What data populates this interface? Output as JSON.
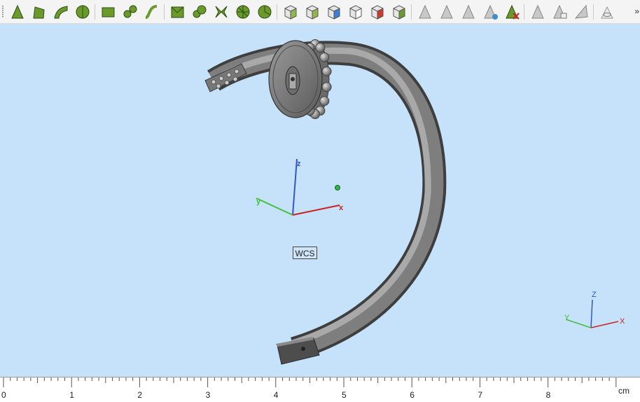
{
  "toolbar": {
    "buttons": [
      {
        "name": "select-vertex-icon"
      },
      {
        "name": "select-edge-icon"
      },
      {
        "name": "select-curve-icon"
      },
      {
        "name": "select-circle-icon"
      },
      {
        "name": "select-face-icon"
      },
      {
        "name": "select-wire-icon"
      },
      {
        "name": "select-spline-icon"
      },
      {
        "name": "select-shell-icon"
      },
      {
        "name": "select-surface-icon"
      },
      {
        "name": "select-compound-face-icon"
      },
      {
        "name": "select-solid-icon"
      },
      {
        "name": "select-sector-icon"
      },
      {
        "name": "view-box-icon"
      },
      {
        "name": "view-box-select-icon"
      },
      {
        "name": "view-box-colored-icon"
      },
      {
        "name": "view-box-outline-icon"
      },
      {
        "name": "view-box-red-icon"
      },
      {
        "name": "view-box-green-icon"
      },
      {
        "name": "measure-icon"
      },
      {
        "name": "measure-angle-icon"
      },
      {
        "name": "measure-distance-icon"
      },
      {
        "name": "measure-refresh-icon"
      },
      {
        "name": "measure-delete-icon"
      },
      {
        "name": "measure-hide-icon"
      },
      {
        "name": "measure-copy-icon"
      },
      {
        "name": "measure-export-icon"
      },
      {
        "name": "visibility-icon"
      }
    ],
    "overflow": "»"
  },
  "viewport": {
    "wcs_label": "WCS",
    "wcs_axes": {
      "x": "x",
      "y": "y",
      "z": "z"
    },
    "corner_axes": {
      "x": "X",
      "y": "Y",
      "z": "Z"
    }
  },
  "ruler": {
    "labels": [
      "0",
      "1",
      "2",
      "3",
      "4",
      "5",
      "6",
      "7",
      "8"
    ],
    "unit": "cm"
  },
  "colors": {
    "background": "#c6e2fa",
    "toolbar_icon_green": "#6b9a2c",
    "axis_x": "#cc2222",
    "axis_y": "#3fbf3f",
    "axis_z": "#3355cc"
  }
}
